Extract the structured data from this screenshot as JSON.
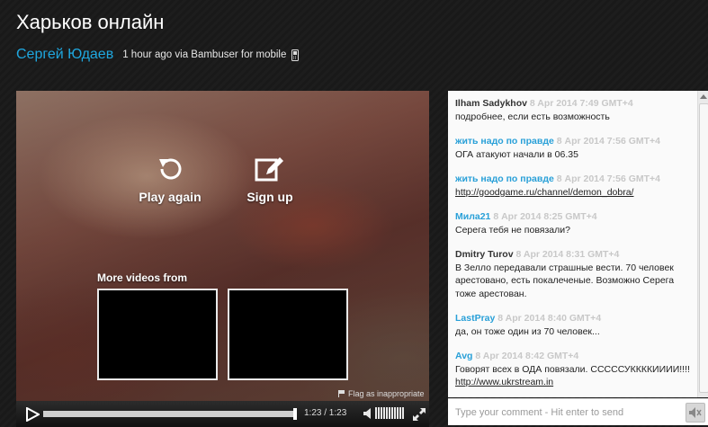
{
  "page": {
    "title": "Харьков онлайн",
    "author": "Сергей Юдаев",
    "meta": "1 hour ago via Bambuser for mobile"
  },
  "player": {
    "replay_label": "Play again",
    "signup_label": "Sign up",
    "more_videos_label": "More videos from",
    "flag_label": "Flag as inappropriate",
    "time": "1:23 / 1:23",
    "progress": 1.0
  },
  "chat": {
    "messages": [
      {
        "name": "Ilham  Sadykhov",
        "time": "8 Apr 2014 7:49 GMT+4",
        "text": "подробнее, если есть возможность"
      },
      {
        "name": "жить надо по правде",
        "time": "8 Apr 2014 7:56 GMT+4",
        "text": "ОГА атакуют начали в 06.35"
      },
      {
        "name": "жить надо по правде",
        "time": "8 Apr 2014 7:56 GMT+4",
        "text": "http://goodgame.ru/channel/demon_dobra/"
      },
      {
        "name": "Мила21",
        "time": "8 Apr 2014 8:25 GMT+4",
        "text": "Серега  тебя не повязали?"
      },
      {
        "name": "Dmitry  Turov",
        "time": "8 Apr 2014 8:31 GMT+4",
        "text": "В Зелло передавали страшные вести. 70 человек арестовано, есть покалеченые. Возможно Серега тоже арестован."
      },
      {
        "name": "LastPray",
        "time": "8 Apr 2014 8:40 GMT+4",
        "text": "да, он тоже один из 70 человек..."
      },
      {
        "name": "Avg",
        "time": "8 Apr 2014 8:42 GMT+4",
        "text": "Говорят всех в ОДА повязали. СССССУККККИИИИ!!!!",
        "link": "http://www.ukrstream.in"
      }
    ],
    "input_placeholder": "Type your comment - Hit enter to send"
  },
  "colors": {
    "accent": "#1fa8e0",
    "chat_name_blue": "#29a0d8",
    "timestamp_grey": "#c8c8c8"
  }
}
